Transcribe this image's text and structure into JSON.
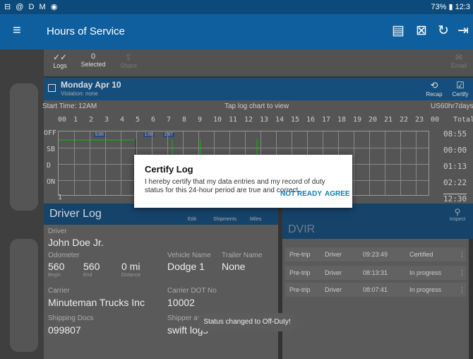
{
  "status_bar": {
    "left_icons": "⊟ @ D M ◉",
    "battery": "73%",
    "time": "12:3"
  },
  "app_bar": {
    "title": "Hours of Service",
    "menu_icon": "menu-icon",
    "icons": [
      "message-icon",
      "document-x-icon",
      "refresh-icon",
      "logout-icon"
    ]
  },
  "toolbar": {
    "logs_label": "Logs",
    "selected_count": "0",
    "selected_label": "Selected",
    "share_label": "Share",
    "right_label": "Email"
  },
  "date_bar": {
    "date": "Monday Apr 10",
    "violation": "Violation: none",
    "recap_label": "Recap",
    "certify_label": "Certify"
  },
  "chart": {
    "start_time": "Start Time: 12AM",
    "hint": "Tap log chart to view",
    "ruleset": "US60hr7days",
    "hours": [
      "00",
      "1",
      "2",
      "3",
      "4",
      "5",
      "6",
      "7",
      "8",
      "9",
      "10",
      "11",
      "12",
      "13",
      "14",
      "15",
      "16",
      "17",
      "18",
      "19",
      "20",
      "21",
      "22",
      "23",
      "00"
    ],
    "total_label": "Total",
    "rows": [
      "OFF",
      "SB",
      "D",
      "ON"
    ],
    "totals": [
      "08:55",
      "00:00",
      "01:13",
      "02:22"
    ],
    "grand_total": "12:30",
    "page": "1",
    "mini_labels": [
      "5:00",
      "1:00",
      "2:07"
    ]
  },
  "driver_log": {
    "title": "Driver Log",
    "actions": [
      "Edit",
      "Shipments",
      "Miles"
    ],
    "driver_label": "Driver",
    "driver": "John Doe Jr.",
    "odometer_label": "Odometer",
    "odo_begin": "560",
    "odo_end": "560",
    "distance": "0 mi",
    "begin_label": "Begin",
    "end_label": "End",
    "distance_label": "Distance",
    "vehicle_label": "Vehicle Name",
    "vehicle": "Dodge 1",
    "trailer_label": "Trailer Name",
    "trailer": "None",
    "carrier_label": "Carrier",
    "carrier": "Minuteman Trucks Inc",
    "dot_label": "Carrier DOT No",
    "dot": "10002",
    "shipping_label": "Shipping Docs",
    "shipping": "099807",
    "shipper_label": "Shipper and Commodity",
    "shipper": "swift logs"
  },
  "dvir": {
    "title": "DVIR",
    "inspect_label": "Inspect",
    "rows": [
      {
        "type": "Pre-trip",
        "who": "Driver",
        "time": "09:23:49",
        "status": "Certified"
      },
      {
        "type": "Pre-trip",
        "who": "Driver",
        "time": "08:13:31",
        "status": "In progress"
      },
      {
        "type": "Pre-trip",
        "who": "Driver",
        "time": "08:07:41",
        "status": "In progress"
      }
    ]
  },
  "dialog": {
    "title": "Certify Log",
    "message": "I hereby certify that my data entries and my record of duty status for this 24-hour period are true and correct.",
    "not_ready": "NOT READY",
    "agree": "AGREE"
  },
  "toast": "Status changed to Off-Duty!"
}
